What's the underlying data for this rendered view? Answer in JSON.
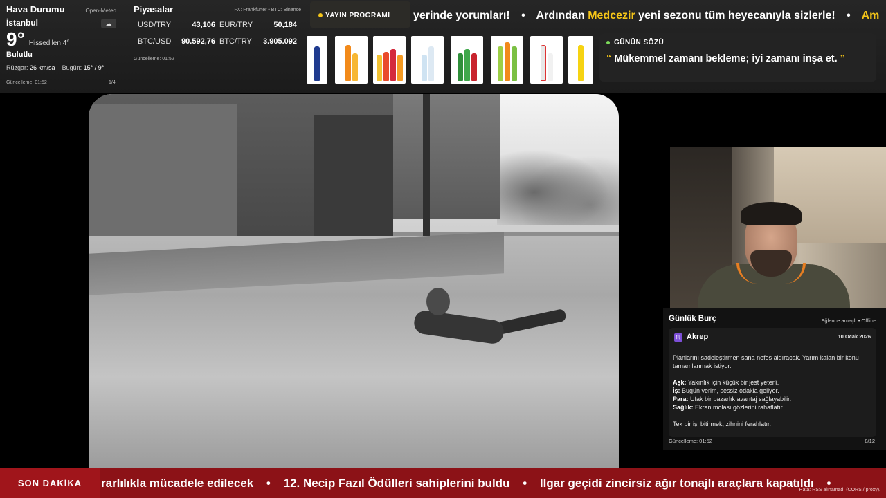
{
  "weather": {
    "title": "Hava Durumu",
    "source": "Open-Meteo",
    "city": "İstanbul",
    "temperature": "9°",
    "feels_like": "Hissedilen 4°",
    "condition": "Bulutlu",
    "wind_label": "Rüzgar:",
    "wind_value": "26 km/sa",
    "today_label": "Bugün:",
    "today_value": "15° / 9°",
    "updated": "Güncelleme: 01:52",
    "page": "1/4",
    "icon": "cloud-icon"
  },
  "markets": {
    "title": "Piyasalar",
    "source": "FX: Frankfurter • BTC: Binance",
    "items": [
      {
        "key": "USD/TRY",
        "value": "43,106"
      },
      {
        "key": "EUR/TRY",
        "value": "50,184"
      },
      {
        "key": "BTC/USD",
        "value": "90.592,76"
      },
      {
        "key": "BTC/TRY",
        "value": "3.905.092"
      }
    ],
    "updated": "Güncelleme: 01:52"
  },
  "schedule": {
    "label": "YAYIN PROGRAMI",
    "ticker_prefix": "yerinde yorumları!",
    "ticker_main_a": "Ardından",
    "ticker_highlight": "Medcezir",
    "ticker_main_b": "yeni sezonu tüm heyecanıyla sizlerle!",
    "ticker_tail": "Am",
    "separator": "•",
    "accent": "#f5c518"
  },
  "quote": {
    "title": "GÜNÜN SÖZÜ",
    "open_mark": "“",
    "text": "Mükemmel zamanı bekleme; iyi zamanı inşa et.",
    "close_mark": "”"
  },
  "horoscope": {
    "title": "Günlük Burç",
    "tag": "Eğlence amaçlı • Offline",
    "sign": "Akrep",
    "sign_icon": "♏",
    "date": "10 Ocak 2026",
    "intro": "Planlarını sadeleştirmen sana nefes aldıracak. Yarım kalan bir konu tamamlanmak istiyor.",
    "love_label": "Aşk:",
    "love": "Yakınlık için küçük bir jest yeterli.",
    "work_label": "İş:",
    "work": "Bugün verim, sessiz odakla geliyor.",
    "money_label": "Para:",
    "money": "Ufak bir pazarlık avantaj sağlayabilir.",
    "health_label": "Sağlık:",
    "health": "Ekran molası gözlerini rahatlatır.",
    "advice": "Tek bir işi bitirmek, zihnini ferahlatır.",
    "updated": "Güncelleme: 01:52",
    "page": "8/12"
  },
  "breaking": {
    "label": "SON DAKİKA",
    "item_1": "rarlılıkla mücadele edilecek",
    "item_2": "12. Necip Fazıl Ödülleri sahiplerini buldu",
    "item_3": "Ilgar geçidi zincirsiz ağır tonajlı araçlara kapatıldı",
    "separator": "•",
    "error": "Hata: RSS alınamadı (CORS / proxy).",
    "color": "#8c1217"
  }
}
